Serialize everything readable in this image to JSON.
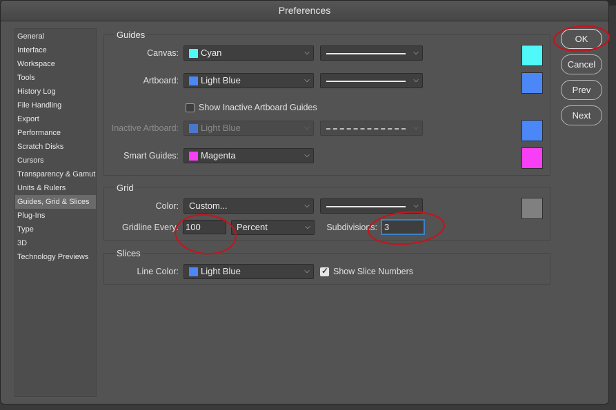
{
  "window": {
    "title": "Preferences"
  },
  "sidebar": {
    "items": [
      {
        "label": "General"
      },
      {
        "label": "Interface"
      },
      {
        "label": "Workspace"
      },
      {
        "label": "Tools"
      },
      {
        "label": "History Log"
      },
      {
        "label": "File Handling"
      },
      {
        "label": "Export"
      },
      {
        "label": "Performance"
      },
      {
        "label": "Scratch Disks"
      },
      {
        "label": "Cursors"
      },
      {
        "label": "Transparency & Gamut"
      },
      {
        "label": "Units & Rulers"
      },
      {
        "label": "Guides, Grid & Slices"
      },
      {
        "label": "Plug-Ins"
      },
      {
        "label": "Type"
      },
      {
        "label": "3D"
      },
      {
        "label": "Technology Previews"
      }
    ],
    "selected": "Guides, Grid & Slices"
  },
  "guides": {
    "title": "Guides",
    "canvas": {
      "label": "Canvas:",
      "color_name": "Cyan",
      "color": "#4ff9f9",
      "style": "solid"
    },
    "artboard": {
      "label": "Artboard:",
      "color_name": "Light Blue",
      "color": "#4b87f7",
      "style": "solid"
    },
    "show_inactive": {
      "label": "Show Inactive Artboard Guides",
      "checked": false
    },
    "inactive_artboard": {
      "label": "Inactive Artboard:",
      "color_name": "Light Blue",
      "color": "#4b87f7",
      "style": "dashed",
      "enabled": false
    },
    "smart_guides": {
      "label": "Smart Guides:",
      "color_name": "Magenta",
      "color": "#f93ff6"
    }
  },
  "grid": {
    "title": "Grid",
    "color": {
      "label": "Color:",
      "value": "Custom...",
      "color": "#808080",
      "style": "solid"
    },
    "gridline_every": {
      "label": "Gridline Every:",
      "value": "100",
      "unit": "Percent"
    },
    "subdivisions": {
      "label": "Subdivisions:",
      "value": "3"
    }
  },
  "slices": {
    "title": "Slices",
    "line_color": {
      "label": "Line Color:",
      "color_name": "Light Blue",
      "color": "#4b87f7"
    },
    "show_numbers": {
      "label": "Show Slice Numbers",
      "checked": true
    }
  },
  "buttons": {
    "ok": "OK",
    "cancel": "Cancel",
    "prev": "Prev",
    "next": "Next"
  },
  "icons": {
    "chevron": "chevron-down-icon",
    "check": "checkmark-icon"
  },
  "annotation_color": "#c4151c"
}
